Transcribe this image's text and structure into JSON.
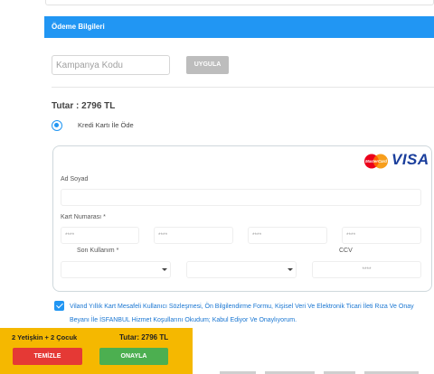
{
  "payment": {
    "section_title": "Ödeme Bilgileri",
    "promo_placeholder": "Kampanya Kodu",
    "apply_label": "UYGULA",
    "total_label": "Tutar : 2796 TL",
    "payment_method_label": "Kredi Kartı İle Öde"
  },
  "card_form": {
    "brand_visa": "VISA",
    "brand_mastercard": "MasterCard",
    "name_label": "Ad Soyad",
    "name_value": "",
    "card_number_label": "Kart Numarası *",
    "card_number_segments": [
      "****",
      "****",
      "****",
      "****"
    ],
    "expiry_label": "Son Kullanım *",
    "expiry_month": "",
    "expiry_year": "",
    "cvv_label": "CCV",
    "cvv_placeholder": "****"
  },
  "terms": {
    "checked": true,
    "text": "Viland Yıllık Kart Mesafeli Kullanıcı Sözleşmesi, Ön Bilgilendirme Formu, Kişisel Veri Ve Elektronik Ticari İleti Rıza Ve Onay Beyanı İle İSFANBUL Hizmet Koşullarını Okudum; Kabul Ediyor Ve Onaylıyorum."
  },
  "bottom_bar": {
    "guests": "2 Yetişkin + 2 Çocuk",
    "total": "Tutar: 2796 TL",
    "clear_label": "TEMİZLE",
    "confirm_label": "ONAYLA"
  },
  "colors": {
    "header_blue": "#2196f3",
    "bar_yellow": "#f5b800",
    "clear_red": "#e53935",
    "confirm_green": "#4caf50",
    "link_blue": "#1976d2"
  }
}
